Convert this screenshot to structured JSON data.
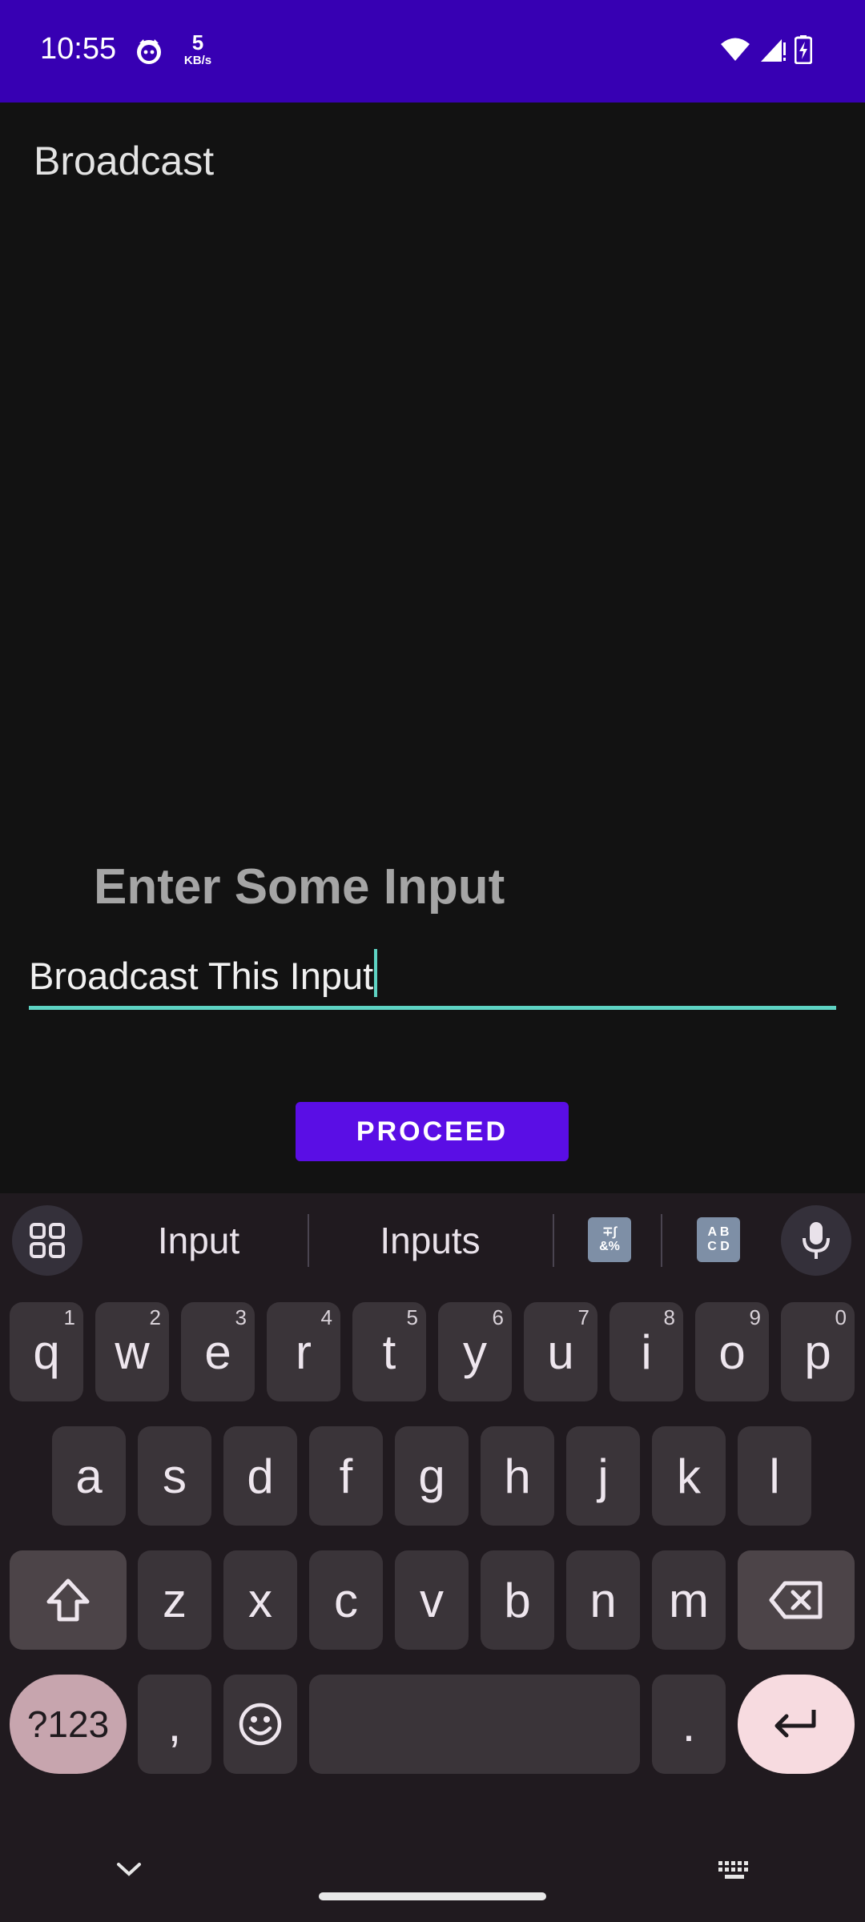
{
  "status_bar": {
    "time": "10:55",
    "net_speed": "5",
    "net_unit": "KB/s",
    "color": "#3700b3"
  },
  "app": {
    "title": "Broadcast"
  },
  "form": {
    "prompt": "Enter Some Input",
    "input_value": "Broadcast This Input",
    "proceed_label": "PROCEED",
    "accent": "#5ed3c3",
    "button_color": "#5a0ee5"
  },
  "keyboard": {
    "suggestions": [
      "Input",
      "Inputs"
    ],
    "row1": [
      {
        "k": "q",
        "h": "1"
      },
      {
        "k": "w",
        "h": "2"
      },
      {
        "k": "e",
        "h": "3"
      },
      {
        "k": "r",
        "h": "4"
      },
      {
        "k": "t",
        "h": "5"
      },
      {
        "k": "y",
        "h": "6"
      },
      {
        "k": "u",
        "h": "7"
      },
      {
        "k": "i",
        "h": "8"
      },
      {
        "k": "o",
        "h": "9"
      },
      {
        "k": "p",
        "h": "0"
      }
    ],
    "row2": [
      "a",
      "s",
      "d",
      "f",
      "g",
      "h",
      "j",
      "k",
      "l"
    ],
    "row3": [
      "z",
      "x",
      "c",
      "v",
      "b",
      "n",
      "m"
    ],
    "symbols_label": "?123",
    "comma": ",",
    "period": ".",
    "icons": {
      "apps": "grid-icon",
      "mic": "mic-icon",
      "shift": "shift-icon",
      "backspace": "backspace-icon",
      "emoji": "emoji-icon",
      "enter": "enter-icon"
    }
  }
}
